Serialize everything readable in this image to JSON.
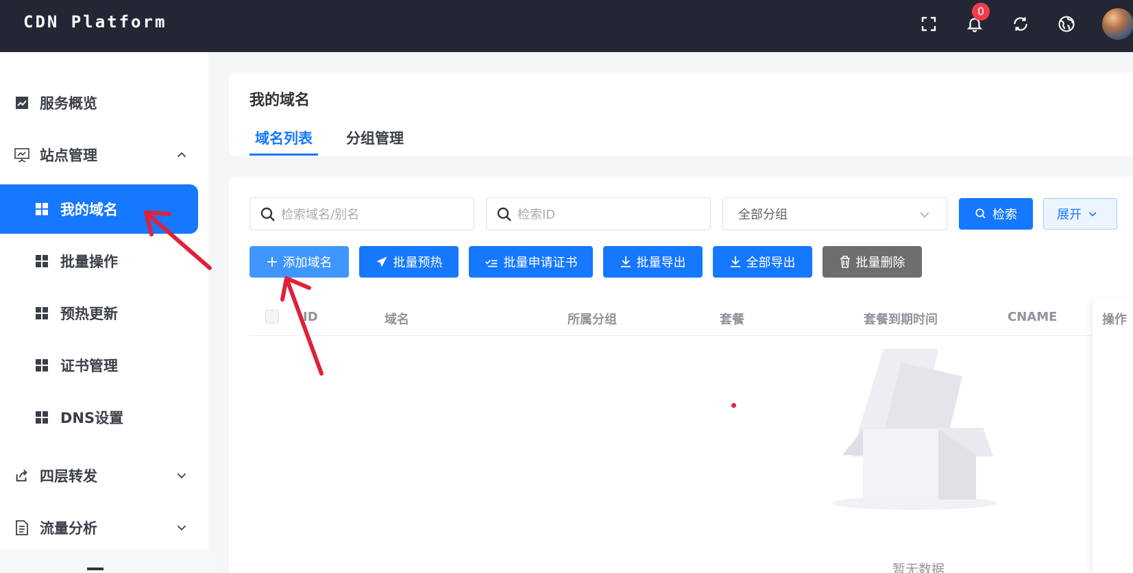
{
  "header": {
    "brand": "CDN Platform",
    "notification_count": "0",
    "icons": [
      "fullscreen-icon",
      "bell-icon",
      "refresh-icon",
      "globe-icon"
    ]
  },
  "sidebar": {
    "items": [
      {
        "label": "服务概览",
        "icon": "chart-line-icon"
      },
      {
        "label": "站点管理",
        "icon": "monitor-icon",
        "expanded": true,
        "children": [
          {
            "label": "我的域名",
            "active": true
          },
          {
            "label": "批量操作"
          },
          {
            "label": "预热更新"
          },
          {
            "label": "证书管理"
          },
          {
            "label": "DNS设置"
          }
        ]
      },
      {
        "label": "四层转发",
        "icon": "share-icon",
        "expanded": false
      },
      {
        "label": "流量分析",
        "icon": "document-icon",
        "expanded": false
      }
    ]
  },
  "main": {
    "title": "我的域名",
    "tabs": [
      {
        "label": "域名列表",
        "active": true
      },
      {
        "label": "分组管理",
        "active": false
      }
    ],
    "filters": {
      "search_domain_placeholder": "检索域名/别名",
      "search_id_placeholder": "检索ID",
      "group_select_value": "全部分组",
      "search_button": "检索",
      "expand_button": "展开"
    },
    "actions": {
      "add_domain": "添加域名",
      "batch_preheat": "批量预热",
      "batch_cert": "批量申请证书",
      "batch_export": "批量导出",
      "export_all": "全部导出",
      "batch_delete": "批量删除"
    },
    "table": {
      "columns": [
        "ID",
        "域名",
        "所属分组",
        "套餐",
        "套餐到期时间",
        "CNAME",
        "操作"
      ],
      "empty_text": "暂无数据"
    }
  },
  "colors": {
    "topbar": "#232733",
    "primary": "#1677ff",
    "badge": "#f23c4c",
    "annotation_arrow": "#e0213a"
  }
}
